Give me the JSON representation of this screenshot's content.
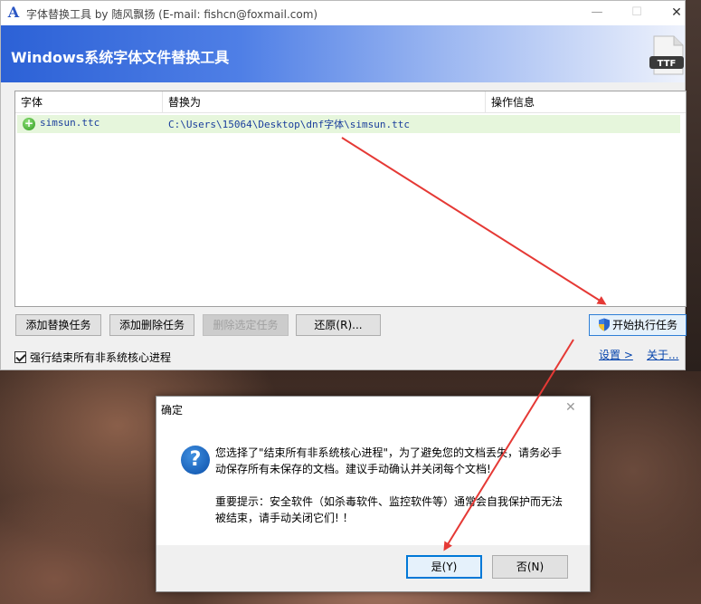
{
  "window": {
    "title": "字体替换工具 by 随风飘扬 (E-mail: fishcn@foxmail.com)",
    "app_icon_glyph": "A",
    "controls": {
      "minimize": "—",
      "maximize": "☐",
      "close": "✕"
    }
  },
  "header": {
    "title": "Windows系统字体文件替换工具",
    "icon_label": "TTF"
  },
  "table": {
    "columns": [
      "字体",
      "替换为",
      "操作信息"
    ],
    "rows": [
      {
        "font": "simsun.ttc",
        "replace_with": "C:\\Users\\15064\\Desktop\\dnf字体\\simsun.ttc",
        "info": "",
        "status_icon": "plus-circle-icon"
      }
    ]
  },
  "buttons": {
    "add_replace": "添加替换任务",
    "add_delete": "添加删除任务",
    "delete_selected": "删除选定任务",
    "restore": "还原(R)...",
    "start": "开始执行任务"
  },
  "options": {
    "force_kill_label": "强行结束所有非系统核心进程",
    "force_kill_checked": true
  },
  "links": {
    "settings": "设置 >",
    "about": "关于..."
  },
  "dialog": {
    "title": "确定",
    "close": "✕",
    "message_1": "您选择了\"结束所有非系统核心进程\"，为了避免您的文档丢失，请务必手动保存所有未保存的文档。建议手动确认并关闭每个文档!",
    "message_2": "重要提示：安全软件（如杀毒软件、监控软件等）通常会自我保护而无法被结束，请手动关闭它们! ！",
    "yes": "是(Y)",
    "no": "否(N)"
  },
  "colors": {
    "accent": "#2c61d6",
    "arrow": "#e53935",
    "row_highlight": "#e6f6dc"
  }
}
